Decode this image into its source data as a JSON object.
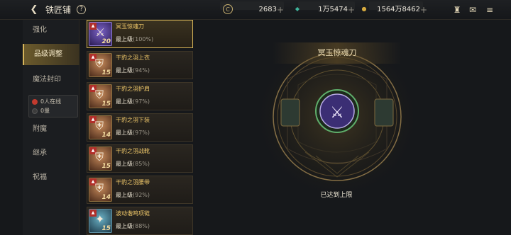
{
  "header": {
    "title": "铁匠铺",
    "help": "?",
    "currencies": [
      {
        "icon": "crystal-icon",
        "symbol": "C",
        "value": "2683",
        "color": "#c8b070"
      },
      {
        "icon": "gem-icon",
        "symbol": "◆",
        "value": "1万5474",
        "color": "#3fb59c"
      },
      {
        "icon": "gold-coin-icon",
        "symbol": "●",
        "value": "1564万8462",
        "color": "#d5a93e"
      }
    ],
    "plus": "+"
  },
  "nav": {
    "items": [
      {
        "label": "强化",
        "active": false
      },
      {
        "label": "品级调整",
        "active": true
      },
      {
        "label": "魔法封印",
        "active": false
      },
      {
        "label": "附魔",
        "active": false
      },
      {
        "label": "继承",
        "active": false
      },
      {
        "label": "祝福",
        "active": false
      }
    ],
    "sub": [
      {
        "label": "0人在线"
      },
      {
        "label": "0量"
      }
    ]
  },
  "items": [
    {
      "name": "冥玉惊魂刀",
      "grade": "最上级",
      "pct": "(100%)",
      "level": "20",
      "style": "purple",
      "glyph": "⚔"
    },
    {
      "name": "干豹之羽上衣",
      "grade": "最上级",
      "pct": "(94%)",
      "level": "15",
      "style": "orange",
      "glyph": "⛨"
    },
    {
      "name": "干豹之羽护肩",
      "grade": "最上级",
      "pct": "(97%)",
      "level": "15",
      "style": "orange",
      "glyph": "⛨"
    },
    {
      "name": "干豹之羽下装",
      "grade": "最上级",
      "pct": "(97%)",
      "level": "14",
      "style": "orange",
      "glyph": "⛨"
    },
    {
      "name": "干豹之羽战靴",
      "grade": "最上级",
      "pct": "(85%)",
      "level": "15",
      "style": "orange",
      "glyph": "⛨"
    },
    {
      "name": "干豹之羽腰带",
      "grade": "最上级",
      "pct": "(92%)",
      "level": "14",
      "style": "orange",
      "glyph": "⛨"
    },
    {
      "name": "波动谐鸣项链",
      "grade": "最上级",
      "pct": "(88%)",
      "level": "15",
      "style": "teal",
      "glyph": "✦"
    }
  ],
  "panel": {
    "title": "冥玉惊魂刀",
    "status": "已达到上限"
  }
}
